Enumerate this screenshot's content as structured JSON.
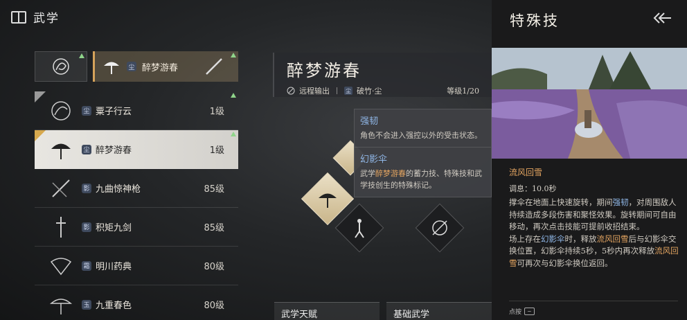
{
  "header": {
    "title": "武学"
  },
  "equipped": {
    "name": "醉梦游春"
  },
  "skills": [
    {
      "name": "粟子行云",
      "grade": "尘",
      "level": "1级"
    },
    {
      "name": "醉梦游春",
      "grade": "尘",
      "level": "1级"
    },
    {
      "name": "九曲惊神枪",
      "grade": "影",
      "level": "85级"
    },
    {
      "name": "积矩九剑",
      "grade": "影",
      "level": "85级"
    },
    {
      "name": "明川药典",
      "grade": "霜",
      "level": "80级"
    },
    {
      "name": "九重春色",
      "grade": "玉",
      "level": "80级"
    }
  ],
  "skill_detail": {
    "name": "醉梦游春",
    "type": "远程输出",
    "grade_icon": "尘",
    "weapon": "破竹·尘",
    "level": "等级1/20"
  },
  "tooltip": {
    "s1_title": "强韧",
    "s1_body": "角色不会进入强控以外的受击状态。",
    "s2_title": "幻影伞",
    "s2_pre": "武学",
    "s2_hl": "醉梦游春",
    "s2_post": "的蓄力技、特殊技和武学技创生的特殊标记。"
  },
  "tabs": {
    "tab1": "武学天赋",
    "tab2": "基础武学"
  },
  "panel": {
    "title": "特殊技",
    "subtitle": "流风回雪",
    "cooldown": "调息：10.0秒",
    "p1a": "撑伞在地面上快速旋转，期间",
    "p1b": "强韧",
    "p1c": "，对周围敌人持续造成多段伤害和聚怪效果。旋转期间可自由移动，再次点击技能可提前收招结束。",
    "p2a": "场上存在",
    "p2b": "幻影伞",
    "p2c": "时，释放",
    "p2d": "流风回雪",
    "p2e": "后与幻影伞交换位置，幻影伞持续5秒，5秒内再次释放",
    "p2f": "流风回雪",
    "p2g": "可再次与幻影伞换位返回。",
    "footer": "点按",
    "footer_key": "~"
  },
  "colors": {
    "accent_gold": "#e4a561",
    "accent_blue": "#8fb6e6",
    "selected_bg": "#e8e6e1"
  }
}
